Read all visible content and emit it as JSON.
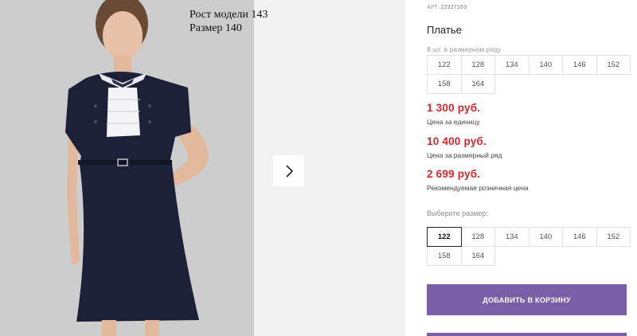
{
  "gallery": {
    "model_height": "Рост модели 143",
    "model_size": "Размер 140",
    "next_icon": "chevron-right-icon"
  },
  "product": {
    "art_label": "АРТ.",
    "art_number": "22327163",
    "title": "Платье",
    "pack_note": "8 шт. в размерном ряду",
    "pack_sizes": [
      "122",
      "128",
      "134",
      "140",
      "146",
      "152",
      "158",
      "164"
    ],
    "prices": {
      "unit_price": "1 300 руб.",
      "unit_label": "Цена за единицу",
      "pack_price": "10 400 руб.",
      "pack_label": "Цена за размерный ряд",
      "retail_price": "2 699 руб.",
      "retail_label": "Рекомендуемая розничная цена"
    },
    "choose_label": "Выберите размер:",
    "choose_sizes": [
      "122",
      "128",
      "134",
      "140",
      "146",
      "152",
      "158",
      "164"
    ],
    "selected_size": "122",
    "add_to_cart": "ДОБАВИТЬ В КОРЗИНУ"
  },
  "colors": {
    "accent": "#7a5fa6",
    "price": "#d8262c",
    "dress": "#1c2137"
  }
}
